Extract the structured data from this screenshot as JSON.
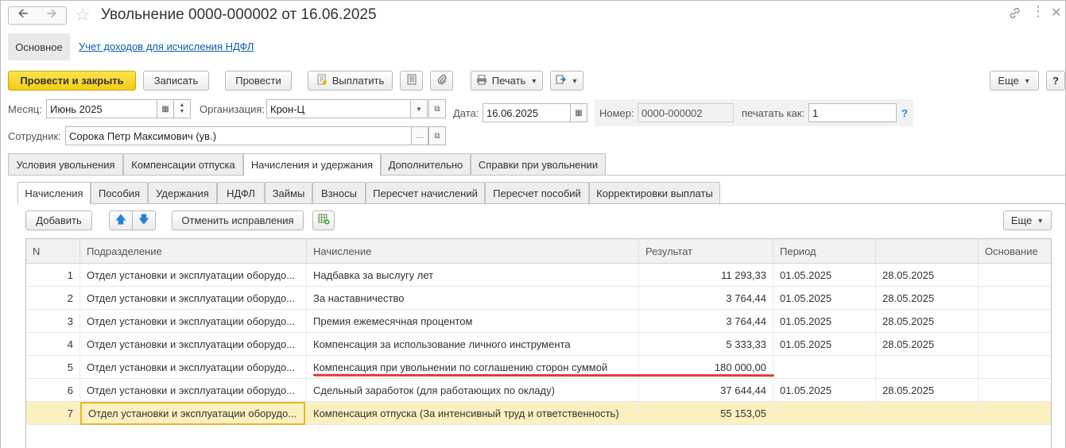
{
  "window": {
    "title": "Увольнение 0000-000002 от 16.06.2025",
    "back_icon": "arrow-left-icon",
    "forward_icon": "arrow-right-icon",
    "favorite_icon": "star-icon",
    "link_icon": "link-icon",
    "menu_icon": "more-icon",
    "close_icon": "close-icon"
  },
  "sections": {
    "main": "Основное",
    "link": "Учет доходов для исчисления НДФЛ"
  },
  "toolbar": {
    "post_close": "Провести и закрыть",
    "write": "Записать",
    "post": "Провести",
    "pay": "Выплатить",
    "print": "Печать",
    "more": "Еще",
    "help": "?"
  },
  "fields": {
    "month_label": "Месяц:",
    "month_value": "Июнь 2025",
    "org_label": "Организация:",
    "org_value": "Крон-Ц",
    "date_label": "Дата:",
    "date_value": "16.06.2025",
    "number_label": "Номер:",
    "number_value": "0000-000002",
    "print_as_label": "печатать как:",
    "print_as_value": "1",
    "print_as_help": "?",
    "employee_label": "Сотрудник:",
    "employee_value": "Сорока Петр Максимович (ув.)"
  },
  "tabs": [
    "Условия увольнения",
    "Компенсации отпуска",
    "Начисления и удержания",
    "Дополнительно",
    "Справки при увольнении"
  ],
  "active_tab": "Начисления и удержания",
  "subtabs": [
    "Начисления",
    "Пособия",
    "Удержания",
    "НДФЛ",
    "Займы",
    "Взносы",
    "Пересчет начислений",
    "Пересчет пособий",
    "Корректировки выплаты"
  ],
  "active_subtab": "Начисления",
  "grid_toolbar": {
    "add": "Добавить",
    "cancel_corrections": "Отменить исправления",
    "more": "Еще"
  },
  "table": {
    "columns": [
      "N",
      "Подразделение",
      "Начисление",
      "Результат",
      "Период",
      "",
      "Основание"
    ],
    "rows": [
      {
        "n": "1",
        "dept": "Отдел установки и эксплуатации оборудо...",
        "accrual": "Надбавка за выслугу лет",
        "result": "11 293,33",
        "from": "01.05.2025",
        "to": "28.05.2025",
        "basis": ""
      },
      {
        "n": "2",
        "dept": "Отдел установки и эксплуатации оборудо...",
        "accrual": "За наставничество",
        "result": "3 764,44",
        "from": "01.05.2025",
        "to": "28.05.2025",
        "basis": ""
      },
      {
        "n": "3",
        "dept": "Отдел установки и эксплуатации оборудо...",
        "accrual": "Премия ежемесячная процентом",
        "result": "3 764,44",
        "from": "01.05.2025",
        "to": "28.05.2025",
        "basis": ""
      },
      {
        "n": "4",
        "dept": "Отдел установки и эксплуатации оборудо...",
        "accrual": "Компенсация за использование личного инструмента",
        "result": "5 333,33",
        "from": "01.05.2025",
        "to": "28.05.2025",
        "basis": ""
      },
      {
        "n": "5",
        "dept": "Отдел установки и эксплуатации оборудо...",
        "accrual": "Компенсация при увольнении по соглашению сторон суммой",
        "result": "180 000,00",
        "from": "",
        "to": "",
        "basis": ""
      },
      {
        "n": "6",
        "dept": "Отдел установки и эксплуатации оборудо...",
        "accrual": "Сдельный заработок (для работающих по окладу)",
        "result": "37 644,44",
        "from": "01.05.2025",
        "to": "28.05.2025",
        "basis": ""
      },
      {
        "n": "7",
        "dept": "Отдел установки и эксплуатации оборудо...",
        "accrual": "Компенсация отпуска (За интенсивный труд и ответственность)",
        "result": "55 153,05",
        "from": "",
        "to": "",
        "basis": ""
      }
    ],
    "selected_row": 7,
    "highlight_color": "#e53935",
    "selection_color": "#fbf0c0"
  }
}
